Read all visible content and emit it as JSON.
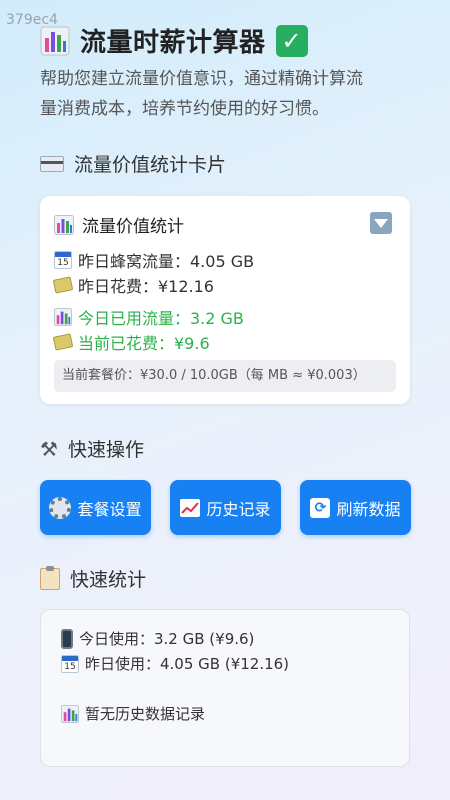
{
  "watermark": "379ec4",
  "header": {
    "title": "流量时薪计算器",
    "subtitle_line1": "帮助您建立流量价值意识，通过精确计算流",
    "subtitle_line2": "量消费成本，培养节约使用的好习惯。"
  },
  "section_card": {
    "heading": "流量价值统计卡片",
    "card_title": "流量价值统计",
    "yesterday_traffic": "昨日蜂窝流量：4.05 GB",
    "yesterday_cost": "昨日花费：¥12.16",
    "today_traffic": "今日已用流量：3.2 GB",
    "today_cost": "当前已花费：¥9.6",
    "plan_price": "当前套餐价：¥30.0 / 10.0GB（每 MB ≈ ¥0.003）"
  },
  "quick_actions": {
    "heading": "快速操作",
    "buttons": [
      {
        "label": "套餐设置",
        "icon": "gear-icon"
      },
      {
        "label": "历史记录",
        "icon": "chart-trend-icon"
      },
      {
        "label": "刷新数据",
        "icon": "refresh-icon"
      }
    ]
  },
  "quick_stats": {
    "heading": "快速统计",
    "today_usage": "今日使用：3.2 GB (¥9.6)",
    "yesterday_usage": "昨日使用：4.05 GB (¥12.16)",
    "empty_history": "暂无历史数据记录"
  },
  "colors": {
    "accent": "#1780f3",
    "green": "#2bb24c",
    "check": "#27ae60"
  }
}
